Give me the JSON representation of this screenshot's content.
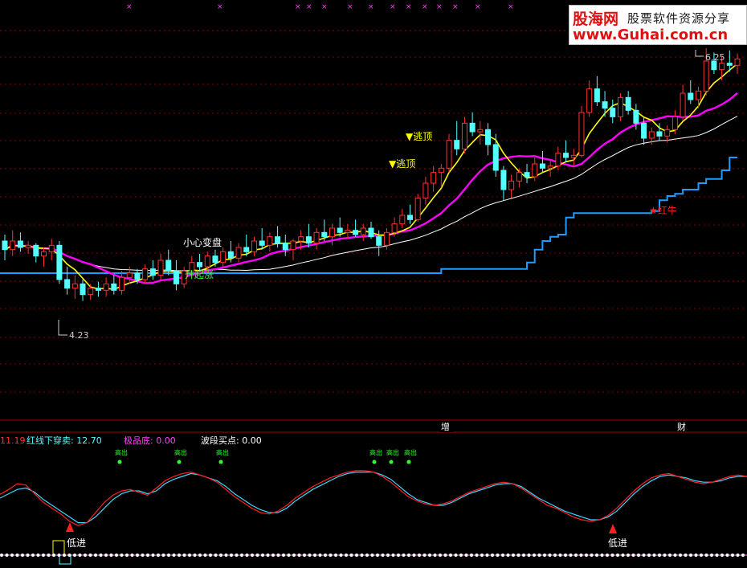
{
  "watermark": {
    "brand": "股海网",
    "slogan": "股票软件资源分享",
    "url": "www.Guhai.com.cn"
  },
  "main_panel": {
    "annotations": {
      "escape_top_1": "▼逃顶",
      "escape_top_2": "▼逃顶",
      "be_careful": "小心变盘",
      "start_rise": "升起涨",
      "red_bull": "★红牛",
      "high_label": "6.25",
      "low_label": "4.23"
    },
    "date_markers": [
      "增",
      "财"
    ]
  },
  "indicator_header": {
    "prefix_value": "11.19",
    "red_cross_sell": "红线下穿卖: 12.70",
    "extreme_bottom": "极品底: 0.00",
    "wave_buy": "波段买点: 0.00"
  },
  "indicator_panel": {
    "top_marks": [
      "高出",
      "高出",
      "高出",
      "高出",
      "高出",
      "高出"
    ],
    "low_entry_labels": [
      "低进",
      "低进"
    ]
  },
  "colors": {
    "background": "#000000",
    "rise": "#ff3030",
    "fall": "#54ffff",
    "ma_short": "#ffff00",
    "ma_mid": "#ff00ff",
    "ma_long": "#ffffff",
    "step_line": "#1e9cff",
    "grid": "#8b0000",
    "osc_red": "#ff2020",
    "osc_cyan": "#3fd6ff",
    "dot": "#ff80ff"
  },
  "chart_data": [
    {
      "type": "candlestick",
      "price_range": [
        3.9,
        6.6
      ],
      "candles": [
        [
          4.8,
          4.86,
          4.62,
          4.72
        ],
        [
          4.72,
          4.9,
          4.66,
          4.8
        ],
        [
          4.8,
          4.88,
          4.7,
          4.74
        ],
        [
          4.74,
          4.8,
          4.68,
          4.76
        ],
        [
          4.76,
          4.78,
          4.6,
          4.66
        ],
        [
          4.66,
          4.74,
          4.56,
          4.7
        ],
        [
          4.7,
          4.82,
          4.62,
          4.76
        ],
        [
          4.76,
          4.8,
          4.4,
          4.44
        ],
        [
          4.44,
          4.56,
          4.3,
          4.36
        ],
        [
          4.36,
          4.48,
          4.26,
          4.4
        ],
        [
          4.4,
          4.44,
          4.24,
          4.3
        ],
        [
          4.3,
          4.4,
          4.25,
          4.36
        ],
        [
          4.36,
          4.42,
          4.28,
          4.34
        ],
        [
          4.34,
          4.46,
          4.28,
          4.4
        ],
        [
          4.4,
          4.48,
          4.3,
          4.34
        ],
        [
          4.34,
          4.52,
          4.3,
          4.46
        ],
        [
          4.46,
          4.56,
          4.4,
          4.5
        ],
        [
          4.5,
          4.54,
          4.4,
          4.44
        ],
        [
          4.44,
          4.58,
          4.4,
          4.54
        ],
        [
          4.54,
          4.62,
          4.44,
          4.48
        ],
        [
          4.48,
          4.68,
          4.44,
          4.62
        ],
        [
          4.62,
          4.72,
          4.48,
          4.52
        ],
        [
          4.52,
          4.62,
          4.34,
          4.4
        ],
        [
          4.4,
          4.56,
          4.36,
          4.52
        ],
        [
          4.52,
          4.66,
          4.46,
          4.6
        ],
        [
          4.6,
          4.68,
          4.52,
          4.56
        ],
        [
          4.56,
          4.7,
          4.5,
          4.66
        ],
        [
          4.66,
          4.72,
          4.56,
          4.6
        ],
        [
          4.6,
          4.74,
          4.54,
          4.7
        ],
        [
          4.7,
          4.8,
          4.6,
          4.64
        ],
        [
          4.64,
          4.78,
          4.6,
          4.74
        ],
        [
          4.74,
          4.86,
          4.66,
          4.7
        ],
        [
          4.7,
          4.84,
          4.66,
          4.8
        ],
        [
          4.8,
          4.92,
          4.72,
          4.76
        ],
        [
          4.76,
          4.88,
          4.7,
          4.84
        ],
        [
          4.84,
          4.94,
          4.74,
          4.78
        ],
        [
          4.78,
          4.86,
          4.66,
          4.72
        ],
        [
          4.72,
          4.82,
          4.62,
          4.8
        ],
        [
          4.8,
          4.9,
          4.72,
          4.84
        ],
        [
          4.84,
          4.96,
          4.74,
          4.78
        ],
        [
          4.78,
          4.92,
          4.72,
          4.88
        ],
        [
          4.88,
          5.0,
          4.8,
          4.84
        ],
        [
          4.84,
          4.96,
          4.76,
          4.92
        ],
        [
          4.92,
          5.02,
          4.84,
          4.88
        ],
        [
          4.88,
          4.96,
          4.82,
          4.9
        ],
        [
          4.9,
          5.0,
          4.84,
          4.86
        ],
        [
          4.86,
          4.96,
          4.8,
          4.92
        ],
        [
          4.92,
          4.98,
          4.82,
          4.84
        ],
        [
          4.84,
          4.9,
          4.66,
          4.76
        ],
        [
          4.76,
          4.92,
          4.72,
          4.88
        ],
        [
          4.88,
          5.02,
          4.84,
          4.96
        ],
        [
          4.96,
          5.1,
          4.92,
          5.04
        ],
        [
          5.04,
          5.14,
          4.96,
          5.0
        ],
        [
          5.0,
          5.24,
          4.98,
          5.2
        ],
        [
          5.2,
          5.4,
          5.14,
          5.34
        ],
        [
          5.34,
          5.5,
          5.26,
          5.44
        ],
        [
          5.44,
          5.52,
          5.3,
          5.48
        ],
        [
          5.48,
          5.8,
          5.44,
          5.74
        ],
        [
          5.74,
          5.92,
          5.6,
          5.66
        ],
        [
          5.66,
          5.96,
          5.62,
          5.9
        ],
        [
          5.9,
          6.0,
          5.78,
          5.82
        ],
        [
          5.82,
          5.92,
          5.7,
          5.84
        ],
        [
          5.84,
          5.9,
          5.6,
          5.7
        ],
        [
          5.7,
          5.8,
          5.4,
          5.46
        ],
        [
          5.46,
          5.5,
          5.18,
          5.28
        ],
        [
          5.28,
          5.42,
          5.2,
          5.36
        ],
        [
          5.36,
          5.48,
          5.3,
          5.44
        ],
        [
          5.44,
          5.52,
          5.34,
          5.4
        ],
        [
          5.4,
          5.58,
          5.36,
          5.52
        ],
        [
          5.52,
          5.64,
          5.44,
          5.48
        ],
        [
          5.48,
          5.56,
          5.4,
          5.5
        ],
        [
          5.5,
          5.68,
          5.46,
          5.62
        ],
        [
          5.62,
          5.74,
          5.54,
          5.58
        ],
        [
          5.58,
          5.66,
          5.5,
          5.6
        ],
        [
          5.6,
          6.06,
          5.58,
          6.0
        ],
        [
          6.0,
          6.3,
          5.96,
          6.22
        ],
        [
          6.22,
          6.34,
          6.06,
          6.1
        ],
        [
          6.1,
          6.2,
          5.96,
          6.04
        ],
        [
          6.04,
          6.12,
          5.9,
          5.96
        ],
        [
          5.96,
          6.18,
          5.92,
          6.14
        ],
        [
          6.14,
          6.2,
          5.98,
          6.02
        ],
        [
          6.02,
          6.08,
          5.84,
          5.9
        ],
        [
          5.9,
          5.96,
          5.7,
          5.76
        ],
        [
          5.76,
          5.86,
          5.7,
          5.82
        ],
        [
          5.82,
          5.9,
          5.74,
          5.78
        ],
        [
          5.78,
          5.88,
          5.72,
          5.84
        ],
        [
          5.84,
          6.02,
          5.8,
          5.96
        ],
        [
          5.96,
          6.26,
          5.92,
          6.18
        ],
        [
          6.18,
          6.3,
          6.08,
          6.12
        ],
        [
          6.12,
          6.24,
          6.04,
          6.2
        ],
        [
          6.2,
          6.6,
          6.16,
          6.48
        ],
        [
          6.48,
          6.56,
          6.36,
          6.4
        ],
        [
          6.4,
          6.52,
          6.3,
          6.46
        ],
        [
          6.46,
          6.58,
          6.38,
          6.44
        ],
        [
          6.44,
          6.55,
          6.36,
          6.5
        ]
      ]
    },
    {
      "type": "line",
      "series_colors": [
        "#ff2020",
        "#3fd6ff"
      ],
      "y_range": [
        0,
        100
      ],
      "red": [
        55,
        62,
        70,
        68,
        56,
        44,
        36,
        28,
        18,
        12,
        16,
        30,
        44,
        54,
        60,
        62,
        58,
        54,
        64,
        74,
        80,
        84,
        86,
        82,
        78,
        72,
        62,
        52,
        44,
        36,
        30,
        28,
        32,
        40,
        50,
        58,
        66,
        72,
        78,
        82,
        86,
        88,
        88,
        86,
        80,
        72,
        62,
        52,
        46,
        42,
        40,
        42,
        46,
        52,
        58,
        62,
        66,
        70,
        72,
        70,
        64,
        56,
        48,
        40,
        36,
        30,
        24,
        20,
        18,
        20,
        26,
        36,
        48,
        60,
        70,
        78,
        82,
        84,
        80,
        76,
        72,
        70,
        72,
        76,
        80,
        82,
        80
      ],
      "cyan": [
        50,
        56,
        62,
        64,
        58,
        48,
        40,
        32,
        24,
        16,
        16,
        24,
        36,
        48,
        56,
        60,
        60,
        56,
        60,
        70,
        76,
        80,
        84,
        82,
        78,
        74,
        66,
        56,
        48,
        40,
        34,
        30,
        30,
        36,
        46,
        54,
        62,
        68,
        74,
        80,
        84,
        86,
        86,
        86,
        82,
        76,
        66,
        56,
        48,
        44,
        40,
        40,
        44,
        50,
        56,
        60,
        64,
        68,
        70,
        70,
        66,
        58,
        50,
        44,
        38,
        32,
        28,
        24,
        20,
        20,
        24,
        32,
        44,
        56,
        66,
        74,
        80,
        82,
        80,
        78,
        74,
        72,
        72,
        74,
        78,
        80,
        80
      ]
    }
  ]
}
